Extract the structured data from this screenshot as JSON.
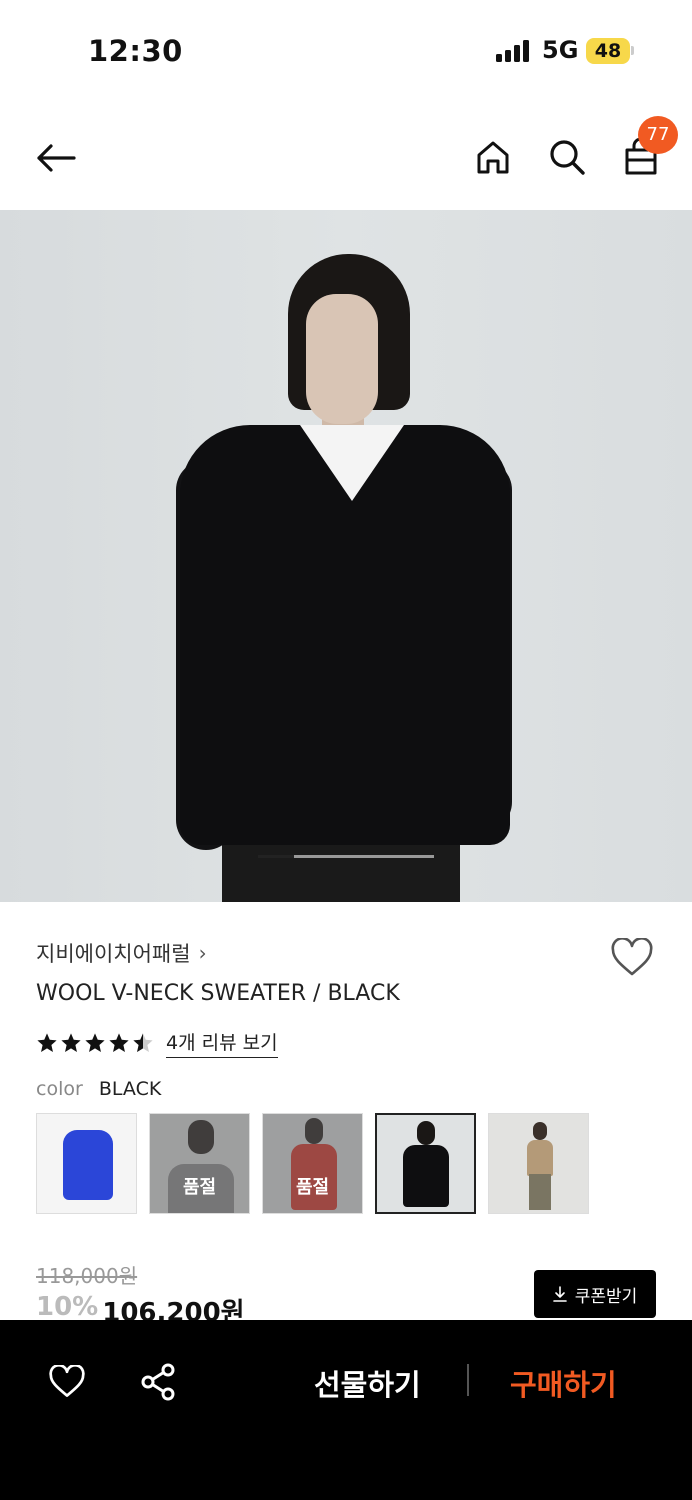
{
  "status_bar": {
    "time": "12:30",
    "network": "5G",
    "battery": "48"
  },
  "header": {
    "back_icon": "arrow-left-icon",
    "home_icon": "home-icon",
    "search_icon": "search-icon",
    "bag_icon": "shopping-bag-icon",
    "cart_count": "77",
    "badge_color": "#f15a22"
  },
  "gallery": {
    "image_index": 1,
    "image_count": 5
  },
  "product": {
    "brand": "지비에이치어패럴",
    "brand_chevron": "›",
    "title": "WOOL V-NECK SWEATER / BLACK",
    "rating": 4.5,
    "review_link": "4개 리뷰 보기",
    "color_label": "color",
    "color_value": "BLACK",
    "swatches": [
      {
        "name": "blue",
        "soldout": ""
      },
      {
        "name": "grey",
        "soldout": "품절"
      },
      {
        "name": "red",
        "soldout": "품절"
      },
      {
        "name": "black",
        "soldout": "",
        "selected": true
      },
      {
        "name": "beige",
        "soldout": ""
      }
    ],
    "original_price": "118,000원",
    "discount": "10%",
    "sale_price": "106,200원",
    "coupon_button": "쿠폰받기",
    "coupon_icon": "download-icon"
  },
  "bottom_bar": {
    "wish_icon": "heart-icon",
    "share_icon": "share-icon",
    "gift": "선물하기",
    "buy": "구매하기",
    "accent": "#f15a22"
  }
}
